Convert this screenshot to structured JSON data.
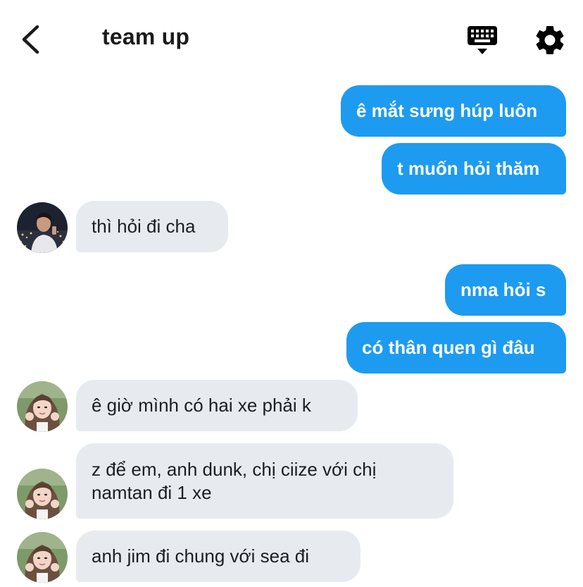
{
  "header": {
    "title": "team up",
    "back_icon": "chevron-left-icon",
    "keyboard_icon": "keyboard-icon",
    "settings_icon": "gear-icon"
  },
  "messages": [
    {
      "direction": "outgoing",
      "text": "ê mắt sưng húp luôn"
    },
    {
      "direction": "outgoing",
      "text": "t muốn hỏi thăm"
    },
    {
      "direction": "incoming",
      "text": "thì hỏi đi cha"
    },
    {
      "direction": "outgoing",
      "text": "nma hỏi s"
    },
    {
      "direction": "outgoing",
      "text": "có thân quen gì đâu"
    },
    {
      "direction": "incoming",
      "text": "ê giờ mình có hai xe phải k"
    },
    {
      "direction": "incoming",
      "text": "z để em, anh dunk, chị ciize với chị namtan đi 1 xe"
    },
    {
      "direction": "incoming",
      "text": "anh jim đi chung với sea đi"
    }
  ],
  "colors": {
    "outgoing_bubble": "#1d9bf0",
    "incoming_bubble": "#e7ebf0"
  }
}
